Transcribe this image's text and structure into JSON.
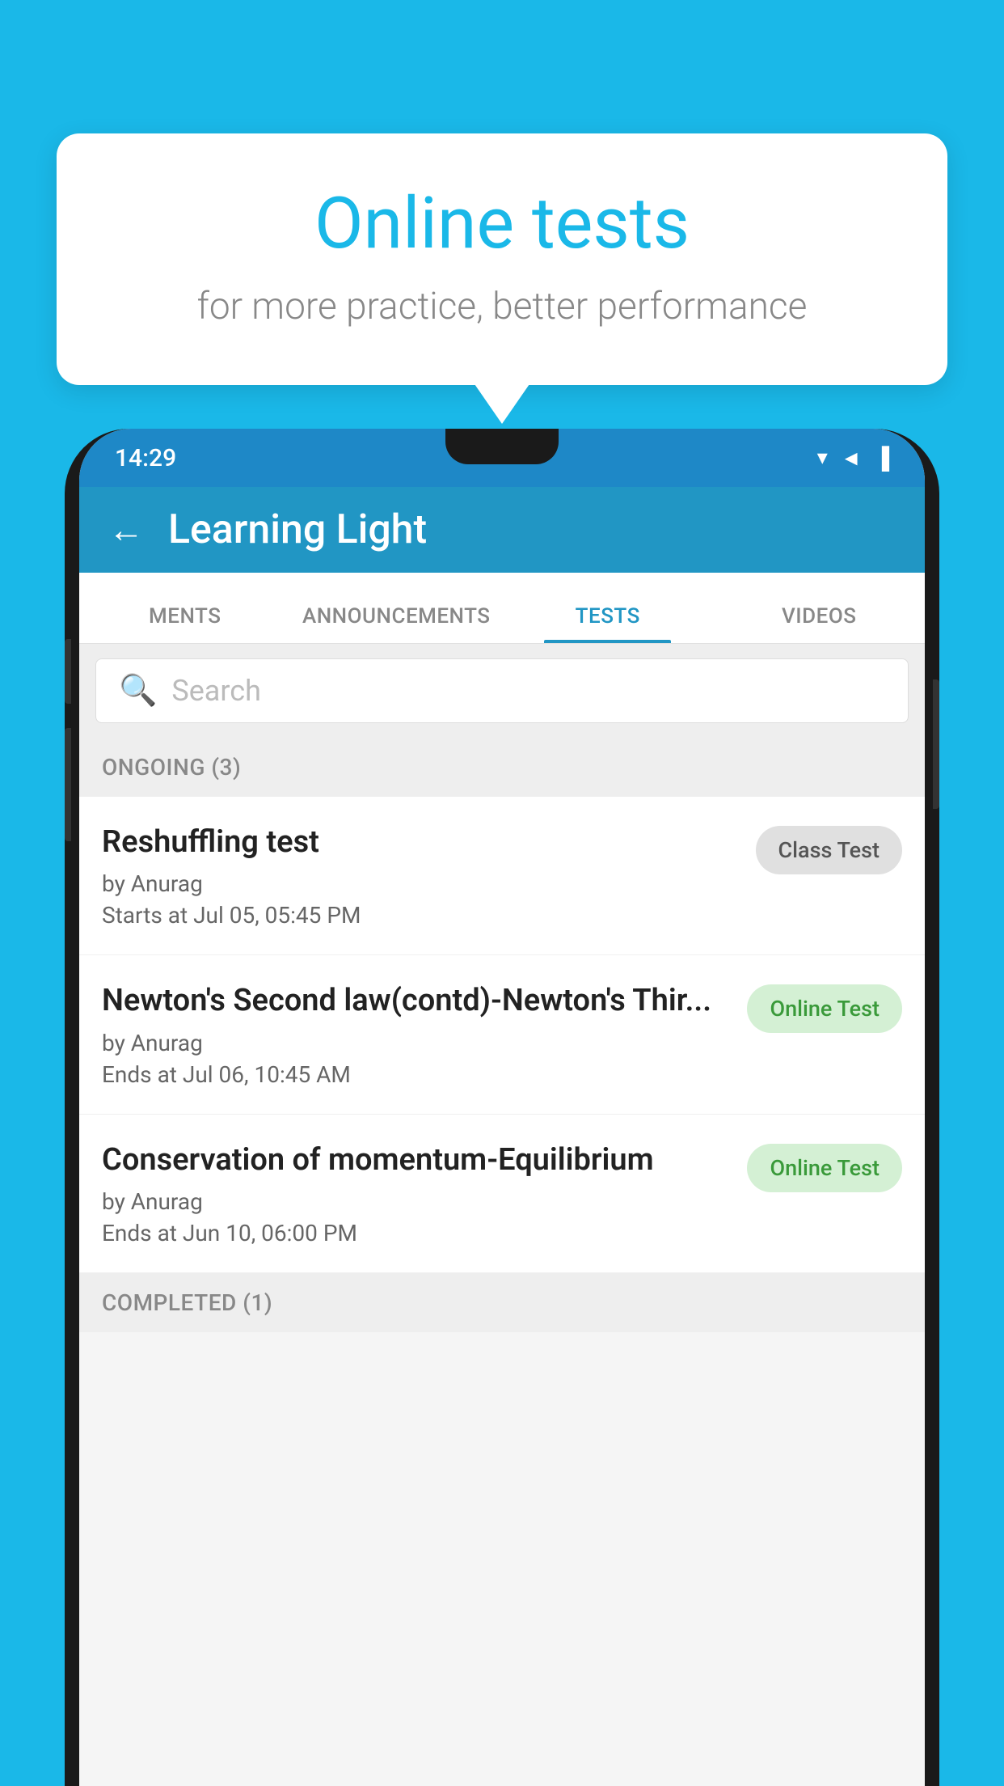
{
  "background": {
    "color": "#1ab8e8"
  },
  "speech_bubble": {
    "title": "Online tests",
    "subtitle": "for more practice, better performance"
  },
  "phone": {
    "status_bar": {
      "time": "14:29",
      "icons": "▼◄▐"
    },
    "app_header": {
      "back_label": "←",
      "title": "Learning Light"
    },
    "tabs": [
      {
        "label": "MENTS",
        "active": false
      },
      {
        "label": "ANNOUNCEMENTS",
        "active": false
      },
      {
        "label": "TESTS",
        "active": true
      },
      {
        "label": "VIDEOS",
        "active": false
      }
    ],
    "search": {
      "placeholder": "Search"
    },
    "ongoing_section": {
      "header": "ONGOING (3)"
    },
    "test_items": [
      {
        "name": "Reshuffling test",
        "author": "by Anurag",
        "date_label": "Starts at",
        "date": "Jul 05, 05:45 PM",
        "badge": "Class Test",
        "badge_type": "class"
      },
      {
        "name": "Newton's Second law(contd)-Newton's Thir...",
        "author": "by Anurag",
        "date_label": "Ends at",
        "date": "Jul 06, 10:45 AM",
        "badge": "Online Test",
        "badge_type": "online"
      },
      {
        "name": "Conservation of momentum-Equilibrium",
        "author": "by Anurag",
        "date_label": "Ends at",
        "date": "Jun 10, 06:00 PM",
        "badge": "Online Test",
        "badge_type": "online"
      }
    ],
    "completed_section": {
      "header": "COMPLETED (1)"
    }
  }
}
